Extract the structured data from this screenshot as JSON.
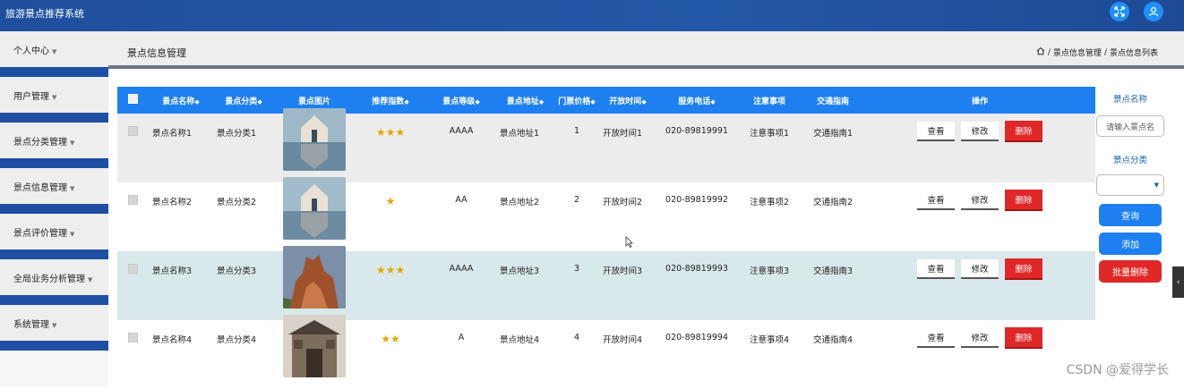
{
  "header": {
    "title": "旅游景点推荐系统",
    "fullscreen_icon": "expand-icon",
    "user_icon": "user-icon"
  },
  "sidebar": {
    "items": [
      {
        "label": "个人中心"
      },
      {
        "label": "用户管理"
      },
      {
        "label": "景点分类管理"
      },
      {
        "label": "景点信息管理"
      },
      {
        "label": "景点评价管理"
      },
      {
        "label": "全局业务分析管理"
      },
      {
        "label": "系统管理"
      }
    ],
    "caret": "▼"
  },
  "page": {
    "title": "景点信息管理",
    "breadcrumb": {
      "home_icon": "home-icon",
      "sep": "/",
      "level1": "景点信息管理",
      "level2": "景点信息列表"
    }
  },
  "table": {
    "columns": [
      "景点名称",
      "景点分类",
      "景点图片",
      "推荐指数",
      "景点等级",
      "景点地址",
      "门票价格",
      "开放时间",
      "服务电话",
      "注意事项",
      "交通指南",
      "操作"
    ],
    "sort_mark": "◆",
    "rows": [
      {
        "name": "景点名称1",
        "category": "景点分类1",
        "stars": 3,
        "stars_text": "★★★",
        "level": "AAAA",
        "address": "景点地址1",
        "price": "1",
        "open": "开放时间1",
        "phone": "020-89819991",
        "notes": "注意事项1",
        "traffic": "交通指南1"
      },
      {
        "name": "景点名称2",
        "category": "景点分类2",
        "stars": 1,
        "stars_text": "★",
        "level": "AA",
        "address": "景点地址2",
        "price": "2",
        "open": "开放时间2",
        "phone": "020-89819992",
        "notes": "注意事项2",
        "traffic": "交通指南2"
      },
      {
        "name": "景点名称3",
        "category": "景点分类3",
        "stars": 3,
        "stars_text": "★★★",
        "level": "AAAA",
        "address": "景点地址3",
        "price": "3",
        "open": "开放时间3",
        "phone": "020-89819993",
        "notes": "注意事项3",
        "traffic": "交通指南3"
      },
      {
        "name": "景点名称4",
        "category": "景点分类4",
        "stars": 2,
        "stars_text": "★★",
        "level": "A",
        "address": "景点地址4",
        "price": "4",
        "open": "开放时间4",
        "phone": "020-89819994",
        "notes": "注意事项4",
        "traffic": "交通指南4"
      }
    ],
    "actions": {
      "view": "查看",
      "edit": "修改",
      "delete": "删除"
    }
  },
  "filter": {
    "name_label": "景点名称",
    "name_placeholder": "请输入景点名",
    "category_label": "景点分类",
    "category_value": "",
    "query_button": "查询",
    "add_button": "添加",
    "batch_delete_button": "批量删除"
  },
  "watermark": "CSDN @爱得学长",
  "colors": {
    "header": "#1f4f9c",
    "primary": "#1e7ff0",
    "danger": "#e02828"
  }
}
